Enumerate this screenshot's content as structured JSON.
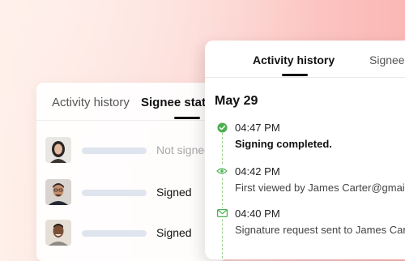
{
  "signee_card": {
    "tabs": [
      {
        "label": "Activity history"
      },
      {
        "label": "Signee status"
      }
    ],
    "signees": [
      {
        "status": "Not signed",
        "avatar": "woman-portrait-avatar"
      },
      {
        "status": "Signed",
        "avatar": "man-glasses-portrait-avatar"
      },
      {
        "status": "Signed",
        "avatar": "man-smiling-portrait-avatar"
      }
    ]
  },
  "activity_card": {
    "tabs": [
      {
        "label": "Activity history"
      },
      {
        "label": "Signee status"
      }
    ],
    "date": "May 29",
    "events": [
      {
        "time": "04:47 PM",
        "description": "Signing completed.",
        "icon": "check-circle-icon"
      },
      {
        "time": "04:42 PM",
        "description": "First viewed by James Carter@gmail.com",
        "icon": "eye-icon"
      },
      {
        "time": "04:40 PM",
        "description": "Signature request sent to James Carter@",
        "icon": "envelope-icon"
      }
    ]
  },
  "colors": {
    "accent_green": "#4caf50",
    "timeline_dash": "#9ccf8a",
    "placeholder_bar": "#dfe5ee"
  }
}
